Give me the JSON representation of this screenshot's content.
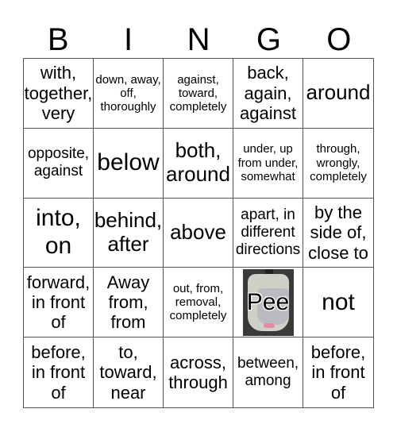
{
  "header": [
    "B",
    "I",
    "N",
    "G",
    "O"
  ],
  "cells": [
    {
      "text": "with, together, very",
      "size": "s20"
    },
    {
      "text": "down, away, off, thoroughly",
      "size": "s14"
    },
    {
      "text": "against, toward, completely",
      "size": "s14"
    },
    {
      "text": "back, again, against",
      "size": "s20"
    },
    {
      "text": "around",
      "size": "s24"
    },
    {
      "text": "opposite, against",
      "size": "s17"
    },
    {
      "text": "below",
      "size": "s28"
    },
    {
      "text": "both, around",
      "size": "s24"
    },
    {
      "text": "under, up from under, somewhat",
      "size": "s14"
    },
    {
      "text": "through, wrongly, completely",
      "size": "s14"
    },
    {
      "text": "into, on",
      "size": "s28"
    },
    {
      "text": "behind, after",
      "size": "s24"
    },
    {
      "text": "above",
      "size": "s24"
    },
    {
      "text": "apart, in different directions",
      "size": "s17"
    },
    {
      "text": "by the side of, close to",
      "size": "s20"
    },
    {
      "text": "forward, in front of",
      "size": "s20"
    },
    {
      "text": "Away from, from",
      "size": "s20"
    },
    {
      "text": "out, from, removal, completely",
      "size": "s14"
    },
    {
      "text": "Pee",
      "size": "free",
      "image": "urinal"
    },
    {
      "text": "not",
      "size": "s28"
    },
    {
      "text": "before, in front of",
      "size": "s20"
    },
    {
      "text": "to, toward, near",
      "size": "s20"
    },
    {
      "text": "across, through",
      "size": "s20"
    },
    {
      "text": "between, among",
      "size": "s17"
    },
    {
      "text": "before, in front of",
      "size": "s20"
    }
  ]
}
